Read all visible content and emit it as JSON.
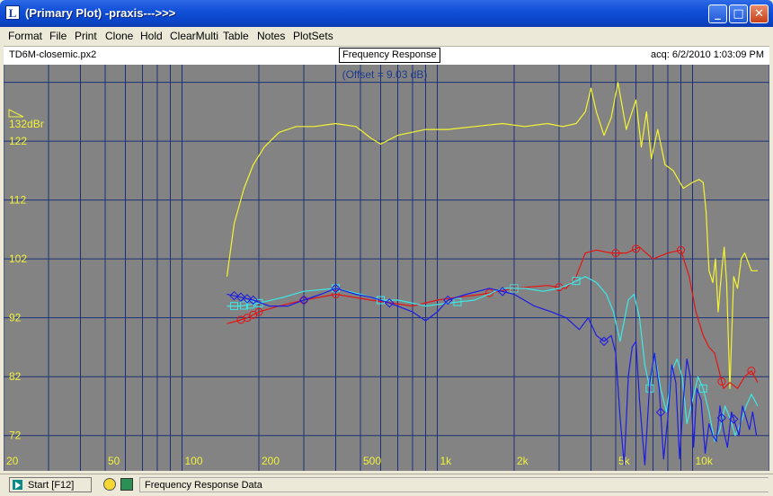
{
  "window": {
    "title": "(Primary Plot) -praxis--->>>",
    "app_icon_letter": "L",
    "controls": {
      "minimize": "_",
      "maximize": "□",
      "close": "✕"
    }
  },
  "menu": [
    "Format",
    "File",
    "Print",
    "Clone",
    "Hold",
    "ClearMulti",
    "Table",
    "Notes",
    "PlotSets"
  ],
  "infobar": {
    "file_name": "TD6M-closemic.px2",
    "plot_title": "Frequency Response",
    "acq_text": "acq: 6/2/2010 1:03:09 PM"
  },
  "status": {
    "start_label": "Start [F12]",
    "text": "Frequency Response Data",
    "icons": [
      "gauge-icon",
      "pen-icon",
      "play-icon"
    ]
  },
  "colors": {
    "plot_bg": "#838383",
    "grid": "#1c3278",
    "label": "#f2f23a",
    "offset": "#1f3b8c",
    "yellow": "#f4f432",
    "red": "#e41414",
    "cyan": "#3ce8e8",
    "blue": "#1c1ce4"
  },
  "chart_data": {
    "type": "line",
    "title": "Frequency Response",
    "subtitle": "(Offset = 9.03 dB)",
    "x_scale": "log",
    "xlim": [
      20,
      20000
    ],
    "ylim": [
      66,
      135
    ],
    "y_top_label": "132dBr",
    "x_ticks": [
      {
        "v": 20,
        "label": "20"
      },
      {
        "v": 50,
        "label": "50"
      },
      {
        "v": 100,
        "label": "100"
      },
      {
        "v": 200,
        "label": "200"
      },
      {
        "v": 500,
        "label": "500"
      },
      {
        "v": 1000,
        "label": "1k"
      },
      {
        "v": 2000,
        "label": "2k"
      },
      {
        "v": 5000,
        "label": "5k"
      },
      {
        "v": 10000,
        "label": "10k"
      }
    ],
    "y_ticks": [
      {
        "v": 122,
        "label": "122"
      },
      {
        "v": 112,
        "label": "112"
      },
      {
        "v": 102,
        "label": "102"
      },
      {
        "v": 92,
        "label": "92"
      },
      {
        "v": 82,
        "label": "82"
      },
      {
        "v": 72,
        "label": "72"
      }
    ],
    "series": [
      {
        "key": "yellow",
        "marker": "none",
        "markers_at": [],
        "x": [
          150,
          160,
          175,
          190,
          210,
          240,
          280,
          330,
          400,
          480,
          550,
          600,
          700,
          900,
          1100,
          1400,
          1800,
          2200,
          2700,
          3100,
          3500,
          3800,
          4000,
          4200,
          4500,
          4800,
          5100,
          5500,
          6000,
          6300,
          6600,
          6900,
          7300,
          7800,
          8400,
          9200,
          10000,
          10600,
          11000,
          11300,
          11600,
          12000,
          12300,
          12600,
          13000,
          13300,
          13600,
          14000,
          14500,
          15000,
          15500,
          16000,
          17000,
          18000
        ],
        "y": [
          99,
          108,
          114,
          118,
          121,
          123.5,
          124.5,
          124.5,
          125,
          124.5,
          122.5,
          121.5,
          123,
          124,
          124,
          124.5,
          125,
          124.5,
          125,
          124.5,
          125,
          127,
          131,
          127,
          123,
          126,
          132,
          124,
          129,
          121,
          127,
          119,
          124,
          118,
          117,
          114,
          115,
          115.5,
          115,
          110,
          100,
          98,
          102,
          93,
          100,
          104,
          98,
          80,
          99,
          97,
          102,
          103,
          100,
          100
        ]
      },
      {
        "key": "red",
        "marker": "circle",
        "markers_at": [
          170,
          180,
          190,
          200,
          300,
          400,
          1600,
          2000,
          3000,
          5000,
          6000,
          9000,
          13000,
          17000
        ],
        "x": [
          150,
          165,
          180,
          200,
          240,
          300,
          400,
          550,
          800,
          1000,
          1200,
          1500,
          2000,
          2700,
          3200,
          3500,
          3800,
          4200,
          4800,
          5500,
          6200,
          7000,
          8000,
          9000,
          9700,
          10300,
          11000,
          11600,
          12200,
          12700,
          13200,
          14000,
          15000,
          16000,
          17000,
          18000
        ],
        "y": [
          91,
          91.5,
          92,
          93,
          94,
          95,
          96,
          95,
          94,
          95,
          95.5,
          96,
          97,
          97.5,
          97,
          99,
          103,
          103.5,
          103,
          103,
          104,
          102,
          103,
          103.5,
          99,
          93,
          89,
          87,
          86,
          83,
          80,
          81,
          80,
          82,
          83,
          81
        ]
      },
      {
        "key": "cyan",
        "marker": "square",
        "markers_at": [
          160,
          175,
          185,
          200,
          400,
          600,
          1200,
          2000,
          3500,
          6800,
          11000
        ],
        "x": [
          150,
          170,
          200,
          250,
          300,
          400,
          500,
          600,
          700,
          800,
          900,
          1100,
          1400,
          1800,
          2200,
          2600,
          3000,
          3400,
          3800,
          4200,
          4600,
          4900,
          5200,
          5600,
          5900,
          6200,
          6500,
          6800,
          7100,
          7500,
          7900,
          8300,
          8700,
          9100,
          9500,
          10000,
          10500,
          11000,
          11600,
          12200,
          12800,
          13400,
          14000,
          14700,
          15400,
          16200,
          17000,
          18000
        ],
        "y": [
          94,
          94,
          94.5,
          95.5,
          96.5,
          97,
          96,
          95,
          95,
          94.5,
          94,
          94.5,
          95,
          97,
          97,
          96.5,
          97,
          98,
          99,
          98,
          96,
          93,
          88,
          95,
          96,
          92,
          84,
          80,
          86,
          80,
          76,
          83,
          85,
          82,
          74,
          78,
          82,
          80,
          76,
          71,
          73,
          77,
          75,
          72,
          74,
          77,
          79,
          77
        ]
      },
      {
        "key": "blue",
        "marker": "diamond",
        "markers_at": [
          160,
          170,
          180,
          190,
          300,
          400,
          650,
          1100,
          1800,
          4500,
          7500,
          13000,
          14500
        ],
        "x": [
          150,
          170,
          190,
          220,
          260,
          300,
          350,
          400,
          480,
          550,
          650,
          800,
          900,
          1000,
          1100,
          1300,
          1600,
          2000,
          2400,
          2800,
          3200,
          3600,
          3900,
          4200,
          4500,
          4800,
          5000,
          5200,
          5400,
          5600,
          5800,
          6000,
          6200,
          6500,
          6800,
          7100,
          7400,
          7700,
          8000,
          8300,
          8600,
          8900,
          9200,
          9500,
          9800,
          10100,
          10400,
          10800,
          11200,
          11600,
          12000,
          12400,
          12800,
          13200,
          13700,
          14200,
          14700,
          15200,
          15700,
          16200,
          16700,
          17200,
          17800
        ],
        "y": [
          96,
          95.5,
          95,
          94,
          94,
          95,
          96,
          97,
          96,
          95.5,
          94.5,
          93,
          91.5,
          93,
          95,
          96,
          97,
          96,
          94,
          93,
          92,
          90,
          92,
          89,
          88,
          89,
          86,
          75,
          67,
          82,
          87,
          88,
          78,
          67,
          81,
          86,
          80,
          68,
          75,
          84,
          81,
          68,
          78,
          85,
          82,
          70,
          80,
          78,
          69,
          74,
          72,
          71,
          77,
          73,
          70,
          76,
          74,
          72,
          77,
          75,
          73,
          76,
          72
        ]
      }
    ]
  }
}
